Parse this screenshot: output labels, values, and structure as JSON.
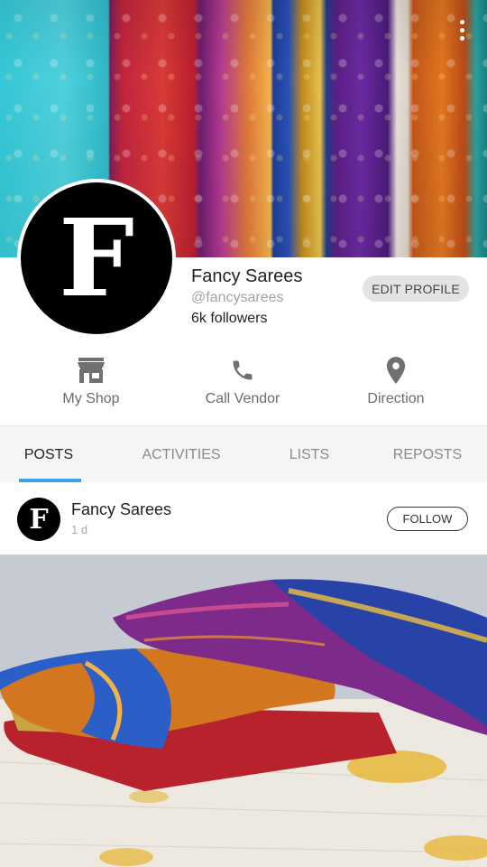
{
  "profile": {
    "name": "Fancy Sarees",
    "handle": "@fancysarees",
    "followers": "6k followers",
    "avatar_letter": "F",
    "edit_label": "EDIT PROFILE"
  },
  "actions": [
    {
      "label": "My Shop",
      "icon": "shop-icon"
    },
    {
      "label": "Call Vendor",
      "icon": "phone-icon"
    },
    {
      "label": "Direction",
      "icon": "location-pin-icon"
    }
  ],
  "tabs": [
    {
      "label": "POSTS",
      "active": true
    },
    {
      "label": "ACTIVITIES",
      "active": false
    },
    {
      "label": "LISTS",
      "active": false
    },
    {
      "label": "REPOSTS",
      "active": false
    }
  ],
  "post": {
    "author": "Fancy Sarees",
    "time": "1 d",
    "avatar_letter": "F",
    "follow_label": "FOLLOW"
  },
  "colors": {
    "accent": "#3aa3e6",
    "icon_gray": "#707070"
  }
}
